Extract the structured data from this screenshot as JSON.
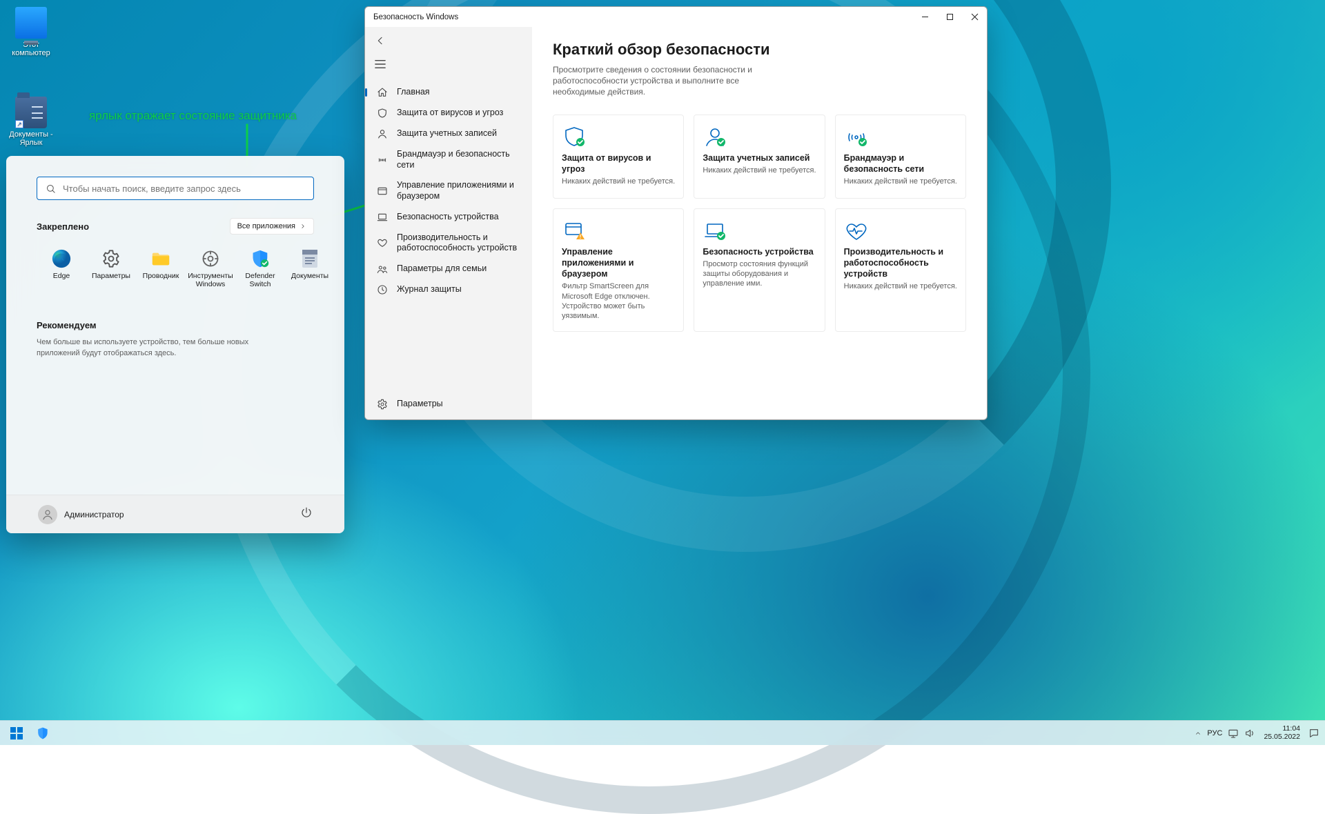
{
  "annotation": {
    "label": "ярлык отражает состояние защитника"
  },
  "desktop": {
    "icons": [
      {
        "name": "this-pc",
        "label": "Этот компьютер"
      },
      {
        "name": "documents-shortcut",
        "label": "Документы - Ярлык"
      }
    ]
  },
  "start_menu": {
    "search_placeholder": "Чтобы начать поиск, введите запрос здесь",
    "pinned_title": "Закреплено",
    "all_apps": "Все приложения",
    "pinned": [
      {
        "name": "edge",
        "label": "Edge"
      },
      {
        "name": "settings",
        "label": "Параметры"
      },
      {
        "name": "explorer",
        "label": "Проводник"
      },
      {
        "name": "windows-tools",
        "label": "Инструменты Windows"
      },
      {
        "name": "defender-switch",
        "label": "Defender Switch"
      },
      {
        "name": "documents",
        "label": "Документы"
      }
    ],
    "recommended_title": "Рекомендуем",
    "recommended_text": "Чем больше вы используете устройство, тем больше новых приложений будут отображаться здесь.",
    "user": "Администратор"
  },
  "security_window": {
    "title": "Безопасность Windows",
    "nav": {
      "home": "Главная",
      "virus": "Защита от вирусов и угроз",
      "account": "Защита учетных записей",
      "firewall": "Брандмауэр и безопасность сети",
      "appbrowser": "Управление приложениями и браузером",
      "device": "Безопасность устройства",
      "performance": "Производительность и работоспособность устройств",
      "family": "Параметры для семьи",
      "history": "Журнал защиты",
      "settings": "Параметры"
    },
    "page": {
      "heading": "Краткий обзор безопасности",
      "sub": "Просмотрите сведения о состоянии безопасности и работоспособности устройства и выполните все необходимые действия."
    },
    "cards": {
      "virus": {
        "title": "Защита от вирусов и угроз",
        "sub": "Никаких действий не требуется."
      },
      "account": {
        "title": "Защита учетных записей",
        "sub": "Никаких действий не требуется."
      },
      "firewall": {
        "title": "Брандмауэр и безопасность сети",
        "sub": "Никаких действий не требуется."
      },
      "appbrowser": {
        "title": "Управление приложениями и браузером",
        "sub": "Фильтр SmartScreen для Microsoft Edge отключен. Устройство может быть уязвимым."
      },
      "device": {
        "title": "Безопасность устройства",
        "sub": "Просмотр состояния функций защиты оборудования и управление ими."
      },
      "performance": {
        "title": "Производительность и работоспособность устройств",
        "sub": "Никаких действий не требуется."
      }
    }
  },
  "taskbar": {
    "lang": "РУС",
    "time": "11:04",
    "date": "25.05.2022"
  }
}
